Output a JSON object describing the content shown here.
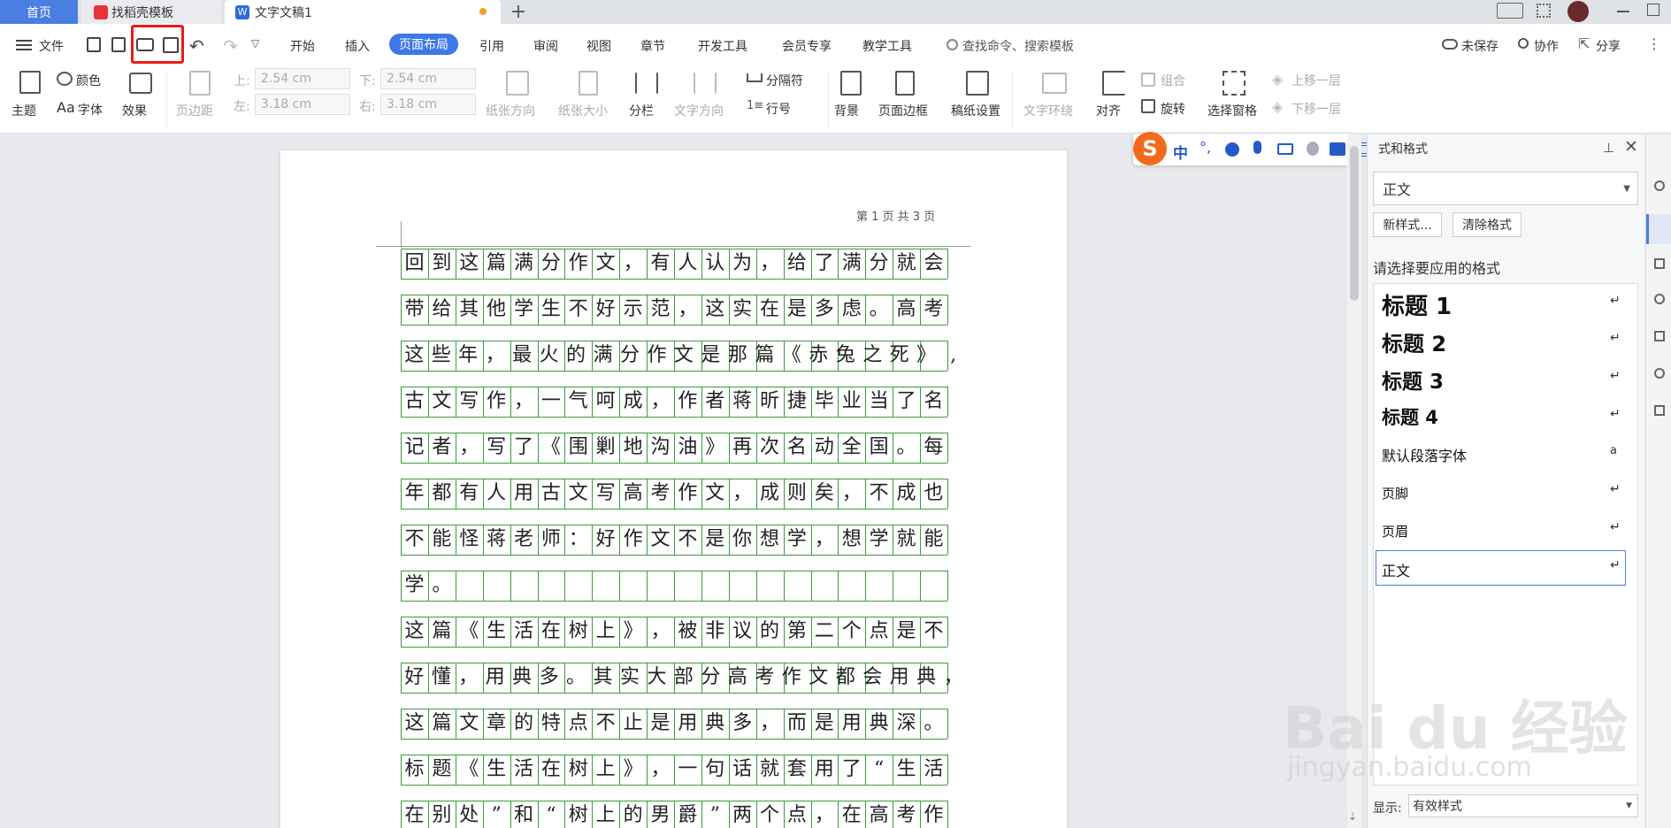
{
  "tabs": {
    "home": "首页",
    "template": "找稻壳模板",
    "doc": "文字文稿1"
  },
  "menubar": {
    "file": "文件",
    "items": [
      "开始",
      "插入",
      "页面布局",
      "引用",
      "审阅",
      "视图",
      "章节",
      "开发工具",
      "会员专享",
      "教学工具"
    ],
    "search": "查找命令、搜索模板",
    "unsaved": "未保存",
    "collab": "协作",
    "share": "分享"
  },
  "ribbon": {
    "theme": "主题",
    "color": "颜色",
    "font": "字体",
    "effect": "效果",
    "margins": "页边距",
    "top_label": "上:",
    "top_value": "2.54 cm",
    "bottom_label": "下:",
    "bottom_value": "2.54 cm",
    "left_label": "左:",
    "left_value": "3.18 cm",
    "right_label": "右:",
    "right_value": "3.18 cm",
    "orientation": "纸张方向",
    "size": "纸张大小",
    "columns": "分栏",
    "text_dir": "文字方向",
    "separator": "分隔符",
    "line_num": "行号",
    "background": "背景",
    "page_border": "页面边框",
    "paper_setup": "稿纸设置",
    "wrap": "文字环绕",
    "align": "对齐",
    "group": "组合",
    "rotate": "旋转",
    "select_pane": "选择窗格",
    "bring_up": "上移一层",
    "send_down": "下移一层"
  },
  "document": {
    "header": "第 1 页 共 3 页",
    "lines": [
      "回到这篇满分作文，有人认为，给了满分就会",
      "带给其他学生不好示范，这实在是多虑。高考",
      "这些年，最火的满分作文是那篇《赤兔之死 》,",
      "古文写作，一气呵成，作者蒋昕捷毕业当了名",
      "记者，写了《围剿地沟油》再次名动全国。每",
      "年都有人用古文写高考作文，成则矣，不成也",
      "不能怪蒋老师：好作文不是你想学，想学就能",
      "学。",
      "这篇《生活在树上 》，被非议的第二个点是不",
      "好懂，用典多。其实大部分高考作文都会用典，",
      "这篇文章的特点不止是用典多，而是用典深。",
      "标题《生活在树上 》，一句话就套用了“生活",
      "在别处”和“树上的男爵”两个点，在高考作"
    ]
  },
  "ime": {
    "mode": "中"
  },
  "panel": {
    "title": "式和格式",
    "current": "正文",
    "new_style": "新样式...",
    "clear": "清除格式",
    "prompt": "请选择要应用的格式",
    "styles": [
      "标题 1",
      "标题 2",
      "标题 3",
      "标题 4",
      "默认段落字体",
      "页脚",
      "页眉",
      "正文"
    ],
    "show_label": "显示:",
    "show_value": "有效样式"
  },
  "watermark": {
    "brand": "Bai du 经验",
    "url": "jingyan.baidu.com"
  }
}
